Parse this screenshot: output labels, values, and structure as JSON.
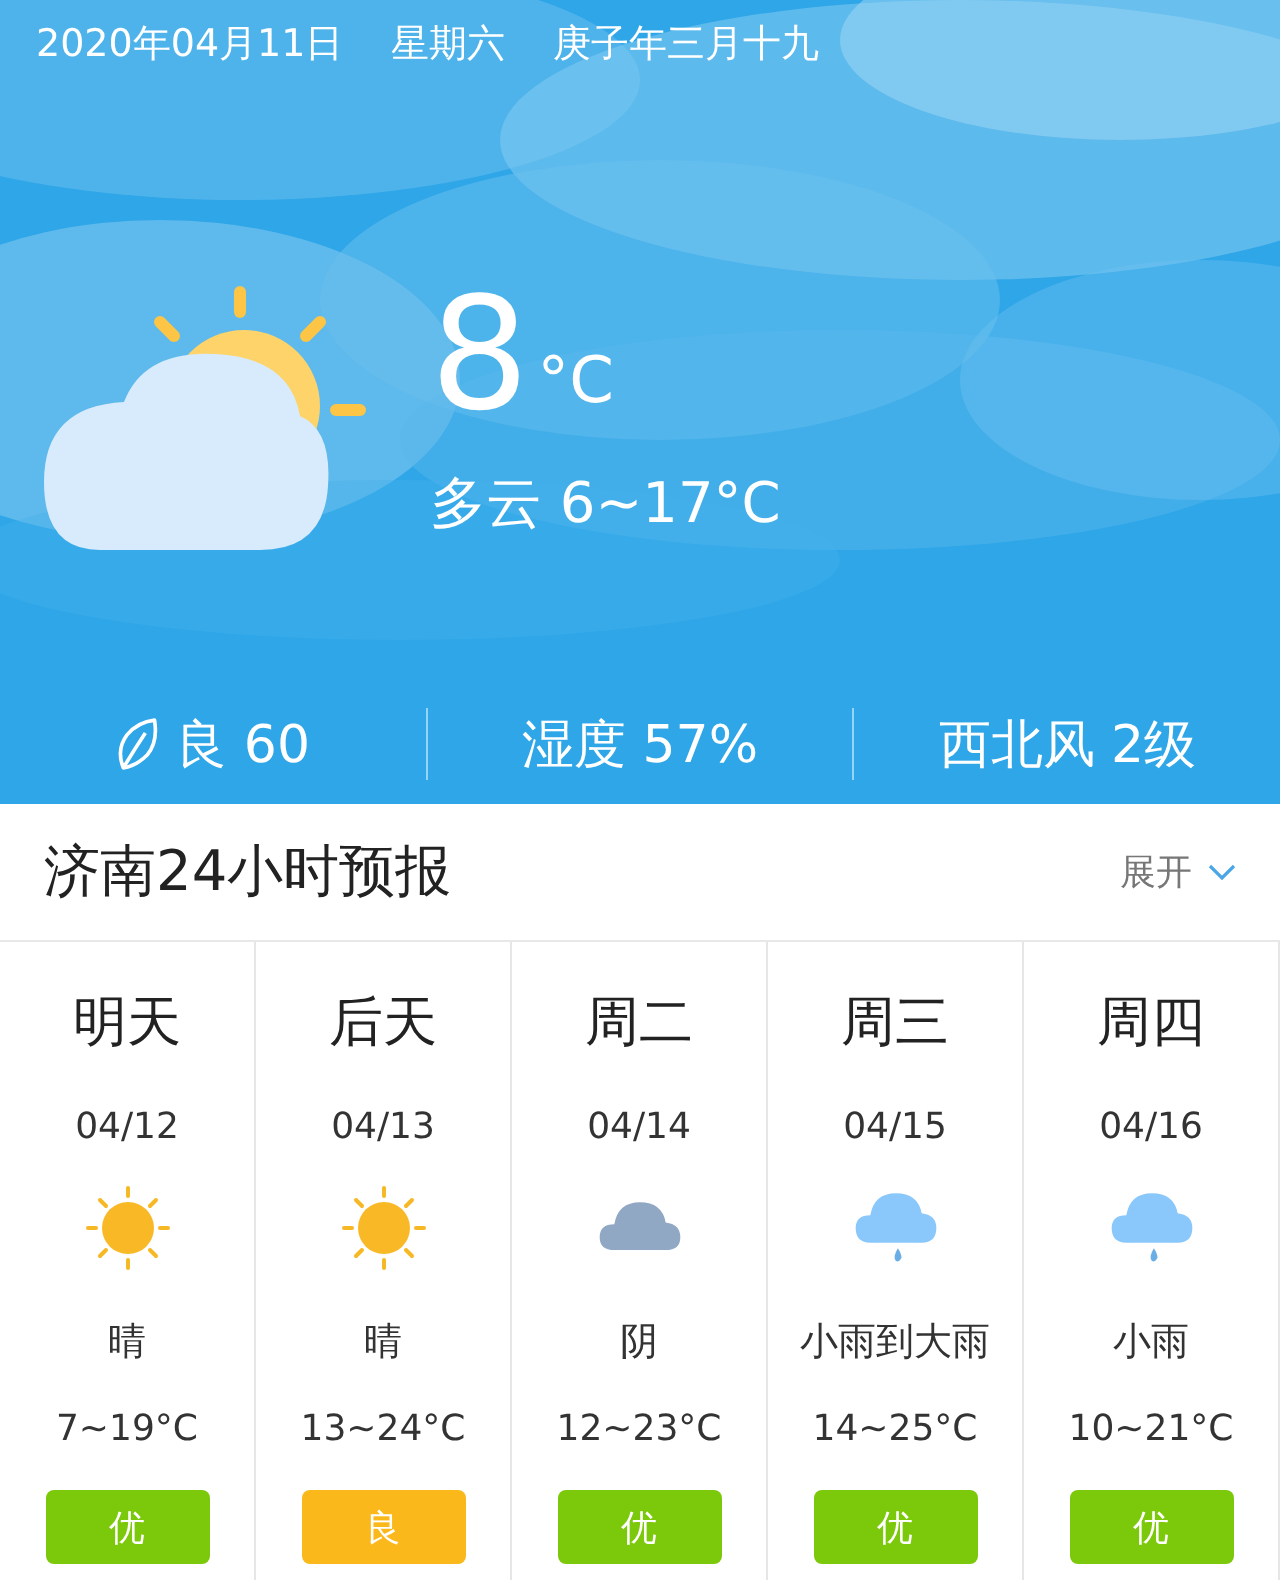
{
  "header": {
    "date": "2020年04月11日",
    "weekday": "星期六",
    "lunar": "庚子年三月十九",
    "kind": "partly-cloudy",
    "temperature": "8",
    "unit": "°C",
    "summary": "多云 6~17°C"
  },
  "stats": [
    {
      "kind": "air",
      "text": "良 60"
    },
    {
      "kind": "plain",
      "text": "湿度 57%"
    },
    {
      "kind": "plain",
      "text": "西北风 2级"
    }
  ],
  "forecast": {
    "title": "济南24小时预报",
    "toggle": "展开",
    "days": [
      {
        "day": "明天",
        "date": "04/12",
        "kind": "sunny",
        "condition": "晴",
        "range": "7~19°C",
        "aqi": "优",
        "color": "#7cc80a"
      },
      {
        "day": "后天",
        "date": "04/13",
        "kind": "sunny",
        "condition": "晴",
        "range": "13~24°C",
        "aqi": "良",
        "color": "#fbb81b"
      },
      {
        "day": "周二",
        "date": "04/14",
        "kind": "overcast",
        "condition": "阴",
        "range": "12~23°C",
        "aqi": "优",
        "color": "#7cc80a"
      },
      {
        "day": "周三",
        "date": "04/15",
        "kind": "rain",
        "condition": "小雨到大雨",
        "range": "14~25°C",
        "aqi": "优",
        "color": "#7cc80a"
      },
      {
        "day": "周四",
        "date": "04/16",
        "kind": "rain",
        "condition": "小雨",
        "range": "10~21°C",
        "aqi": "优",
        "color": "#7cc80a"
      }
    ]
  }
}
